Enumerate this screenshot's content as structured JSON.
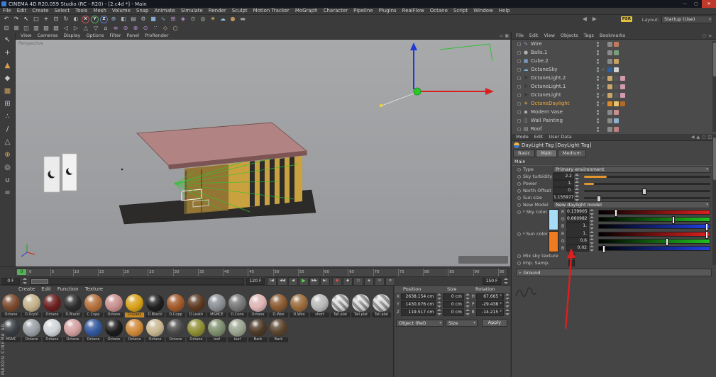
{
  "window": {
    "title": "CINEMA 4D R20.059 Studio (RC - R20) - [2.c4d *] - Main"
  },
  "menu": [
    "File",
    "Edit",
    "Create",
    "Select",
    "Tools",
    "Mesh",
    "Volume",
    "Snap",
    "Animate",
    "Simulate",
    "Render",
    "Sculpt",
    "Motion Tracker",
    "MoGraph",
    "Character",
    "Pipeline",
    "Plugins",
    "RealFlow",
    "Octane",
    "Script",
    "Window",
    "Help"
  ],
  "toolbar": {
    "layout_label": "Layout:",
    "layout_value": "Startup (Use)",
    "psr": "PSR",
    "row1": [
      {
        "name": "undo-icon",
        "g": "↶",
        "c": "#d8d8d8"
      },
      {
        "name": "redo-icon",
        "g": "↷",
        "c": "#d8d8d8"
      },
      {
        "name": "live-selection-icon",
        "g": "↖",
        "c": "#ececec"
      },
      {
        "name": "rect-selection-icon",
        "g": "□",
        "c": "#d0d0d0"
      },
      {
        "name": "move-tool-icon",
        "g": "+",
        "c": "#e0e0e0"
      },
      {
        "name": "scale-tool-icon",
        "g": "⊡",
        "c": "#d0d0d0"
      },
      {
        "name": "rotate-tool-icon",
        "g": "↻",
        "c": "#d0d0d0"
      },
      {
        "name": "last-tool-icon",
        "g": "◐",
        "c": "#b8b8b8"
      },
      {
        "name": "x-axis-lock-icon",
        "g": "X",
        "c": "#e8e8e8",
        "cls": "ring",
        "ring": "#c85050"
      },
      {
        "name": "y-axis-lock-icon",
        "g": "Y",
        "c": "#e8e8e8",
        "cls": "ring",
        "ring": "#58a858"
      },
      {
        "name": "z-axis-lock-icon",
        "g": "Z",
        "c": "#e8e8e8",
        "cls": "ring",
        "ring": "#5878c8"
      },
      {
        "name": "coordinate-system-icon",
        "g": "⊕",
        "c": "#8fb0cc"
      },
      {
        "name": "render-view-icon",
        "g": "◧",
        "c": "#aab6c2"
      },
      {
        "name": "render-picture-viewer-icon",
        "g": "▤",
        "c": "#aab6c2"
      },
      {
        "name": "render-settings-icon",
        "g": "⚙",
        "c": "#aab6c2"
      },
      {
        "name": "add-cube-icon",
        "g": "■",
        "c": "#82aad2"
      },
      {
        "name": "add-spline-icon",
        "g": "∿",
        "c": "#82aad2"
      },
      {
        "name": "mograph-icon",
        "g": "⊞",
        "c": "#b892d2"
      },
      {
        "name": "deformer-icon",
        "g": "◈",
        "c": "#b892d2"
      },
      {
        "name": "simulate-icon",
        "g": "⊙",
        "c": "#a8b8a0"
      },
      {
        "name": "camera-icon",
        "g": "◎",
        "c": "#a8c0a8"
      },
      {
        "name": "light-icon",
        "g": "☀",
        "c": "#e2ca62"
      },
      {
        "name": "sky-icon",
        "g": "☁",
        "c": "#92c2e2"
      },
      {
        "name": "material-icon",
        "g": "●",
        "c": "#c29262"
      },
      {
        "name": "floor-icon",
        "g": "▬",
        "c": "#a2a2a2"
      }
    ],
    "row2": [
      {
        "name": "array-tool-icon",
        "g": "⊟",
        "c": "#c2c2c2"
      },
      {
        "name": "boole-tool-icon",
        "g": "⊠",
        "c": "#c2c2c2"
      },
      {
        "name": "connect-tool-icon",
        "g": "◫",
        "c": "#c2c2c2"
      },
      {
        "name": "instance-tool-icon",
        "g": "▥",
        "c": "#c2c2c2"
      },
      {
        "name": "metaball-tool-icon",
        "g": "▨",
        "c": "#c2c2c2"
      },
      {
        "name": "symmetry-tool-icon",
        "g": "▧",
        "c": "#c2c2c2"
      },
      {
        "name": "spline-mask-icon",
        "g": "◁",
        "c": "#c2c2c2"
      },
      {
        "name": "extrude-tool-icon",
        "g": "▷",
        "c": "#c2c2c2"
      },
      {
        "name": "lathe-tool-icon",
        "g": "△",
        "c": "#c2c2c2"
      },
      {
        "name": "loft-tool-icon",
        "g": "▽",
        "c": "#c2c2c2"
      },
      {
        "name": "sweep-tool-icon",
        "g": "⌂",
        "c": "#c2c2c2"
      },
      {
        "name": "bend-deformer-icon",
        "g": "≡",
        "c": "#b892d2"
      },
      {
        "name": "bulge-deformer-icon",
        "g": "⊘",
        "c": "#b892d2"
      },
      {
        "name": "shear-deformer-icon",
        "g": "⊗",
        "c": "#b892d2"
      },
      {
        "name": "taper-deformer-icon",
        "g": "⊙",
        "c": "#b892d2"
      },
      {
        "name": "ffd-deformer-icon",
        "g": "∵",
        "c": "#b892d2"
      },
      {
        "name": "snap-tool-icon",
        "g": "◇",
        "c": "#d2b892"
      },
      {
        "name": "magnet-tool-icon",
        "g": "○",
        "c": "#d2b892"
      }
    ],
    "nav": [
      {
        "name": "nav-back-icon",
        "g": "◀",
        "c": "#9a9a9a"
      },
      {
        "name": "nav-forward-icon",
        "g": "▶",
        "c": "#9a9a9a"
      },
      {
        "name": "nav-prev-icon",
        "g": "◀",
        "c": "#3a3a3a"
      },
      {
        "name": "nav-next-icon",
        "g": "▶",
        "c": "#3a3a3a"
      }
    ]
  },
  "left_tools": [
    {
      "name": "live-selection-tool",
      "g": "↖",
      "c": "#d8d8d8"
    },
    {
      "name": "move-tool",
      "g": "+",
      "c": "#d0d0d0"
    },
    {
      "name": "make-editable",
      "g": "▲",
      "c": "#d8a050"
    },
    {
      "name": "model-mode",
      "g": "◆",
      "c": "#c8c8c8"
    },
    {
      "name": "texture-mode",
      "g": "▦",
      "c": "#c8a060"
    },
    {
      "name": "workplane-mode",
      "g": "⊞",
      "c": "#a8c0d8"
    },
    {
      "name": "points-mode",
      "g": "∴",
      "c": "#c8c8c8"
    },
    {
      "name": "edges-mode",
      "g": "/",
      "c": "#c8c8c8"
    },
    {
      "name": "polygons-mode",
      "g": "△",
      "c": "#c8c8c8"
    },
    {
      "name": "enable-axis",
      "g": "⊕",
      "c": "#d8b050"
    },
    {
      "name": "solo-mode",
      "g": "◎",
      "c": "#c8c8c8"
    },
    {
      "name": "snap-toggle",
      "g": "∪",
      "c": "#d8d8d8"
    },
    {
      "name": "workplane-lock",
      "g": "≡",
      "c": "#a8a8a8"
    }
  ],
  "viewport": {
    "menu": [
      "View",
      "Cameras",
      "Display",
      "Options",
      "Filter",
      "Panel",
      "ProRender"
    ],
    "label": "Perspective"
  },
  "object_manager": {
    "menu": [
      "File",
      "Edit",
      "View",
      "Objects",
      "Tags",
      "Bookmarks"
    ],
    "objects": [
      {
        "name": "Wire",
        "icon": "∿",
        "icon_c": "#9ab4d4",
        "tag1": "#8a8a8a",
        "tag2": "#c47a5a"
      },
      {
        "name": "Balls.1",
        "icon": "●",
        "icon_c": "#b0b0b0",
        "tag1": "#8a8a8a",
        "tag2": "#7aa07a"
      },
      {
        "name": "Cube.2",
        "icon": "■",
        "icon_c": "#7a9ac0",
        "tag1": "#8a8a8a",
        "tag2": "#c8a060"
      },
      {
        "name": "OctaneSky",
        "icon": "☁",
        "icon_c": "#79b5e2",
        "checkcls": "on",
        "tag1": "#2e5f9e",
        "tag2": "#cfcfcf"
      },
      {
        "name": "OctaneLight.2",
        "icon": "☀",
        "icon_c": "#2b2b2b",
        "checkcls": "on",
        "tag1": "#caa66a",
        "tag2": "#555555",
        "tag3": "#d49ab0"
      },
      {
        "name": "OctaneLight.1",
        "icon": "☀",
        "icon_c": "#2b2b2b",
        "checkcls": "on",
        "tag1": "#caa66a",
        "tag2": "#555555",
        "tag3": "#d49ab0"
      },
      {
        "name": "OctaneLight",
        "icon": "☀",
        "icon_c": "#2b2b2b",
        "checkcls": "on",
        "tag1": "#caa66a",
        "tag2": "#555555",
        "tag3": "#d49ab0"
      },
      {
        "name": "OctaneDaylight",
        "icon": "☀",
        "icon_c": "#e8b33a",
        "state": "selected",
        "checkcls": "on",
        "tag1": "#e08a2a",
        "tag2": "#e8c36a",
        "tag3": "#b06a2a"
      },
      {
        "name": "Modern Vase",
        "icon": "◆",
        "icon_c": "#b0b0b0",
        "tag1": "#8a8a8a",
        "tag2": "#cc8f8f"
      },
      {
        "name": "Wall Painting",
        "icon": "▯",
        "icon_c": "#b0b0b0",
        "tag1": "#8a8a8a",
        "tag2": "#8fb2cc"
      },
      {
        "name": "Roof",
        "icon": "▤",
        "icon_c": "#b0b0b0",
        "tag1": "#8a8a8a",
        "tag2": "#c08080"
      }
    ]
  },
  "attributes": {
    "menu": [
      "Mode",
      "Edit",
      "User Data"
    ],
    "title": "DayLight Tag [DayLight Tag]",
    "tabs": [
      {
        "label": "Basic"
      },
      {
        "label": "Main",
        "state": "selected"
      },
      {
        "label": "Medium"
      }
    ],
    "section": "Main",
    "fields": {
      "type_label": "Type",
      "type_value": "Primary environment",
      "turbidity_label": "Sky turbidity",
      "turbidity_value": "2.2",
      "power_label": "Power",
      "power_value": "1.",
      "north_label": "North Offset",
      "north_value": "0.",
      "sunsize_label": "Sun size",
      "sunsize_value": "1.155977",
      "model_label": "New Model",
      "model_value": "New daylight model",
      "sky_label": "Sky color",
      "sky_swatch": "#a6dcf5",
      "sun_label": "Sun color",
      "sun_swatch": "#ef7b1e",
      "mix_label": "Mix sky texture",
      "imp_label": "Imp. Samp.",
      "ground_label": "Ground"
    },
    "sky_channels": [
      {
        "ch": "R",
        "value": "0.139905",
        "pos": "14%"
      },
      {
        "ch": "G",
        "value": "0.660982",
        "pos": "66%"
      },
      {
        "ch": "B",
        "value": "1.",
        "pos": "96%"
      }
    ],
    "sun_channels": [
      {
        "ch": "R",
        "value": "1.",
        "pos": "96%"
      },
      {
        "ch": "G",
        "value": "0.6",
        "pos": "60%"
      },
      {
        "ch": "B",
        "value": "0.02",
        "pos": "3%"
      }
    ]
  },
  "timeline": {
    "ticks": [
      "0",
      "5",
      "10",
      "15",
      "20",
      "25",
      "30",
      "35",
      "40",
      "45",
      "50",
      "55",
      "60",
      "65",
      "70",
      "75",
      "80",
      "85",
      "90",
      "95"
    ],
    "marker": "0",
    "current": "0 F",
    "range_end": "120 F",
    "max": "150 F",
    "transport": [
      {
        "name": "goto-start-button",
        "g": "|◀",
        "cls": ""
      },
      {
        "name": "prev-key-button",
        "g": "◀◀",
        "cls": ""
      },
      {
        "name": "prev-frame-button",
        "g": "◀",
        "cls": ""
      },
      {
        "name": "play-button",
        "g": "▶",
        "cls": "play"
      },
      {
        "name": "next-frame-button",
        "g": "▶▶",
        "cls": ""
      },
      {
        "name": "goto-end-button",
        "g": "▶|",
        "cls": ""
      }
    ],
    "keybtns": [
      {
        "name": "record-button",
        "g": "●",
        "cls": "rec"
      },
      {
        "name": "keyframe-button",
        "g": "◆",
        "cls": ""
      },
      {
        "name": "autokey-button",
        "g": "○",
        "cls": ""
      },
      {
        "name": "record-position-button",
        "g": "◈",
        "cls": ""
      },
      {
        "name": "record-scale-button",
        "g": "⊙",
        "cls": ""
      },
      {
        "name": "record-params-button",
        "g": "≡",
        "cls": ""
      }
    ]
  },
  "materials": {
    "menu": [
      "Create",
      "Edit",
      "Function",
      "Texture"
    ],
    "row1": [
      {
        "name": "Octane",
        "c": "#7a4a2e"
      },
      {
        "name": "D.DryVi",
        "c": "#c4b28c"
      },
      {
        "name": "Octane",
        "c": "#6b2020"
      },
      {
        "name": "D.Blackl",
        "c": "#2d2d2d"
      },
      {
        "name": "C.Copp",
        "c": "#b5713d"
      },
      {
        "name": "Octane",
        "c": "#c98f8f"
      },
      {
        "name": "O.Glass",
        "c": "#d8a21c",
        "state": "selected"
      },
      {
        "name": "D.Blackl",
        "c": "#1f1f1f"
      },
      {
        "name": "D.Copp",
        "c": "#a35a2a"
      },
      {
        "name": "D.Leath",
        "c": "#5d3a22"
      },
      {
        "name": "MSMCE",
        "c": "#8a8f94"
      },
      {
        "name": "D.Cono",
        "c": "#777777"
      },
      {
        "name": "Octane",
        "c": "#e0b4b4"
      },
      {
        "name": "D.Woo",
        "c": "#8a5a32"
      },
      {
        "name": "D.Woo",
        "c": "#9a6b3c"
      },
      {
        "name": "short",
        "c": "#b9b9b9"
      },
      {
        "name": "Tall plat",
        "c": "#cfcfcf",
        "checker": "checker"
      },
      {
        "name": "Tall plat",
        "c": "#cfcfcf",
        "checker": "checker"
      },
      {
        "name": "Tall plat",
        "c": "#cfcfcf",
        "checker": "checker"
      }
    ],
    "row2": [
      {
        "name": "MSMC",
        "c": "#3a3f45"
      },
      {
        "name": "Octane",
        "c": "#9aa0a6"
      },
      {
        "name": "Octane",
        "c": "#cfd4d8"
      },
      {
        "name": "Octane",
        "c": "#d3a0a0"
      },
      {
        "name": "Octane",
        "c": "#33589e"
      },
      {
        "name": "Octane",
        "c": "#1c1c1c"
      },
      {
        "name": "Octane",
        "c": "#d08a3a"
      },
      {
        "name": "Octane",
        "c": "#c9b792"
      },
      {
        "name": "Octane",
        "c": "#4a4a4a"
      },
      {
        "name": "Octane",
        "c": "#8f8f35"
      },
      {
        "name": "leaf",
        "c": "#7e8f6e"
      },
      {
        "name": "leaf",
        "c": "#9aa48e"
      },
      {
        "name": "Bark",
        "c": "#4e3a28"
      },
      {
        "name": "Bark",
        "c": "#5a442e"
      }
    ]
  },
  "coordinates": {
    "headers": [
      "Position",
      "Size",
      "Rotation"
    ],
    "rows": [
      {
        "axis": "X",
        "pos": "2638.154 cm",
        "size": "0 cm",
        "raxis": "H",
        "rot": "67.665 °"
      },
      {
        "axis": "Y",
        "pos": "1430.076 cm",
        "size": "0 cm",
        "raxis": "P",
        "rot": "-29.438 °"
      },
      {
        "axis": "Z",
        "pos": "119.517 cm",
        "size": "0 cm",
        "raxis": "B",
        "rot": "-14.215 °"
      }
    ],
    "object_mode": "Object (Rel)",
    "size_mode": "Size",
    "apply": "Apply"
  },
  "branding": "MAXON  CINEMA 4D"
}
